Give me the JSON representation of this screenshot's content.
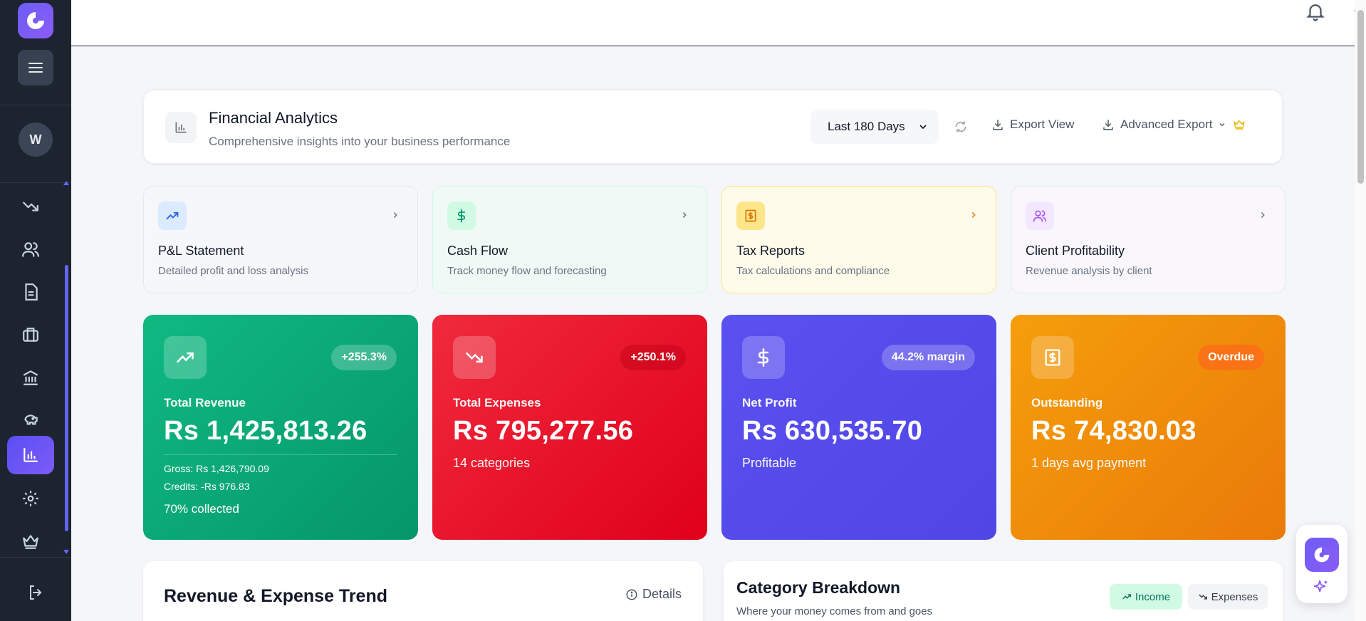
{
  "sidebar": {
    "avatar_initial": "W",
    "nav_icons": [
      "trending-down-icon",
      "users-icon",
      "file-text-icon",
      "briefcase-icon",
      "bank-icon",
      "piggy-bank-icon",
      "bar-chart-icon",
      "gear-icon",
      "crown-icon"
    ],
    "active_item": "bar-chart-icon"
  },
  "header": {
    "title": "Financial Analytics",
    "subtitle": "Comprehensive insights into your business performance",
    "date_range": "Last 180 Days",
    "export_view_label": "Export View",
    "advanced_export_label": "Advanced Export"
  },
  "quick_reports": [
    {
      "title": "P&L Statement",
      "subtitle": "Detailed profit and loss analysis",
      "icon": "trending-up-icon",
      "accent": "#3b82f6"
    },
    {
      "title": "Cash Flow",
      "subtitle": "Track money flow and forecasting",
      "icon": "dollar-icon",
      "accent": "#10b981"
    },
    {
      "title": "Tax Reports",
      "subtitle": "Tax calculations and compliance",
      "icon": "receipt-icon",
      "accent": "#f59e0b"
    },
    {
      "title": "Client Profitability",
      "subtitle": "Revenue analysis by client",
      "icon": "users-icon",
      "accent": "#a855f7"
    }
  ],
  "stats": [
    {
      "label": "Total Revenue",
      "value": "Rs 1,425,813.26",
      "badge": "+255.3%",
      "gross": "Gross: Rs 1,426,790.09",
      "credits": "Credits: -Rs 976.83",
      "collected": "70% collected",
      "color": "#10b981"
    },
    {
      "label": "Total Expenses",
      "value": "Rs 795,277.56",
      "badge": "+250.1%",
      "extra": "14 categories",
      "color": "#ef1b2f"
    },
    {
      "label": "Net Profit",
      "value": "Rs 630,535.70",
      "badge": "44.2% margin",
      "extra": "Profitable",
      "color": "#5b4ef3"
    },
    {
      "label": "Outstanding",
      "value": "Rs 74,830.03",
      "badge": "Overdue",
      "extra": "1 days avg payment",
      "color": "#f59e0b"
    }
  ],
  "trend": {
    "title": "Revenue & Expense Trend",
    "details_label": "Details"
  },
  "category": {
    "title": "Category Breakdown",
    "subtitle": "Where your money comes from and goes",
    "income_label": "Income",
    "expenses_label": "Expenses"
  }
}
